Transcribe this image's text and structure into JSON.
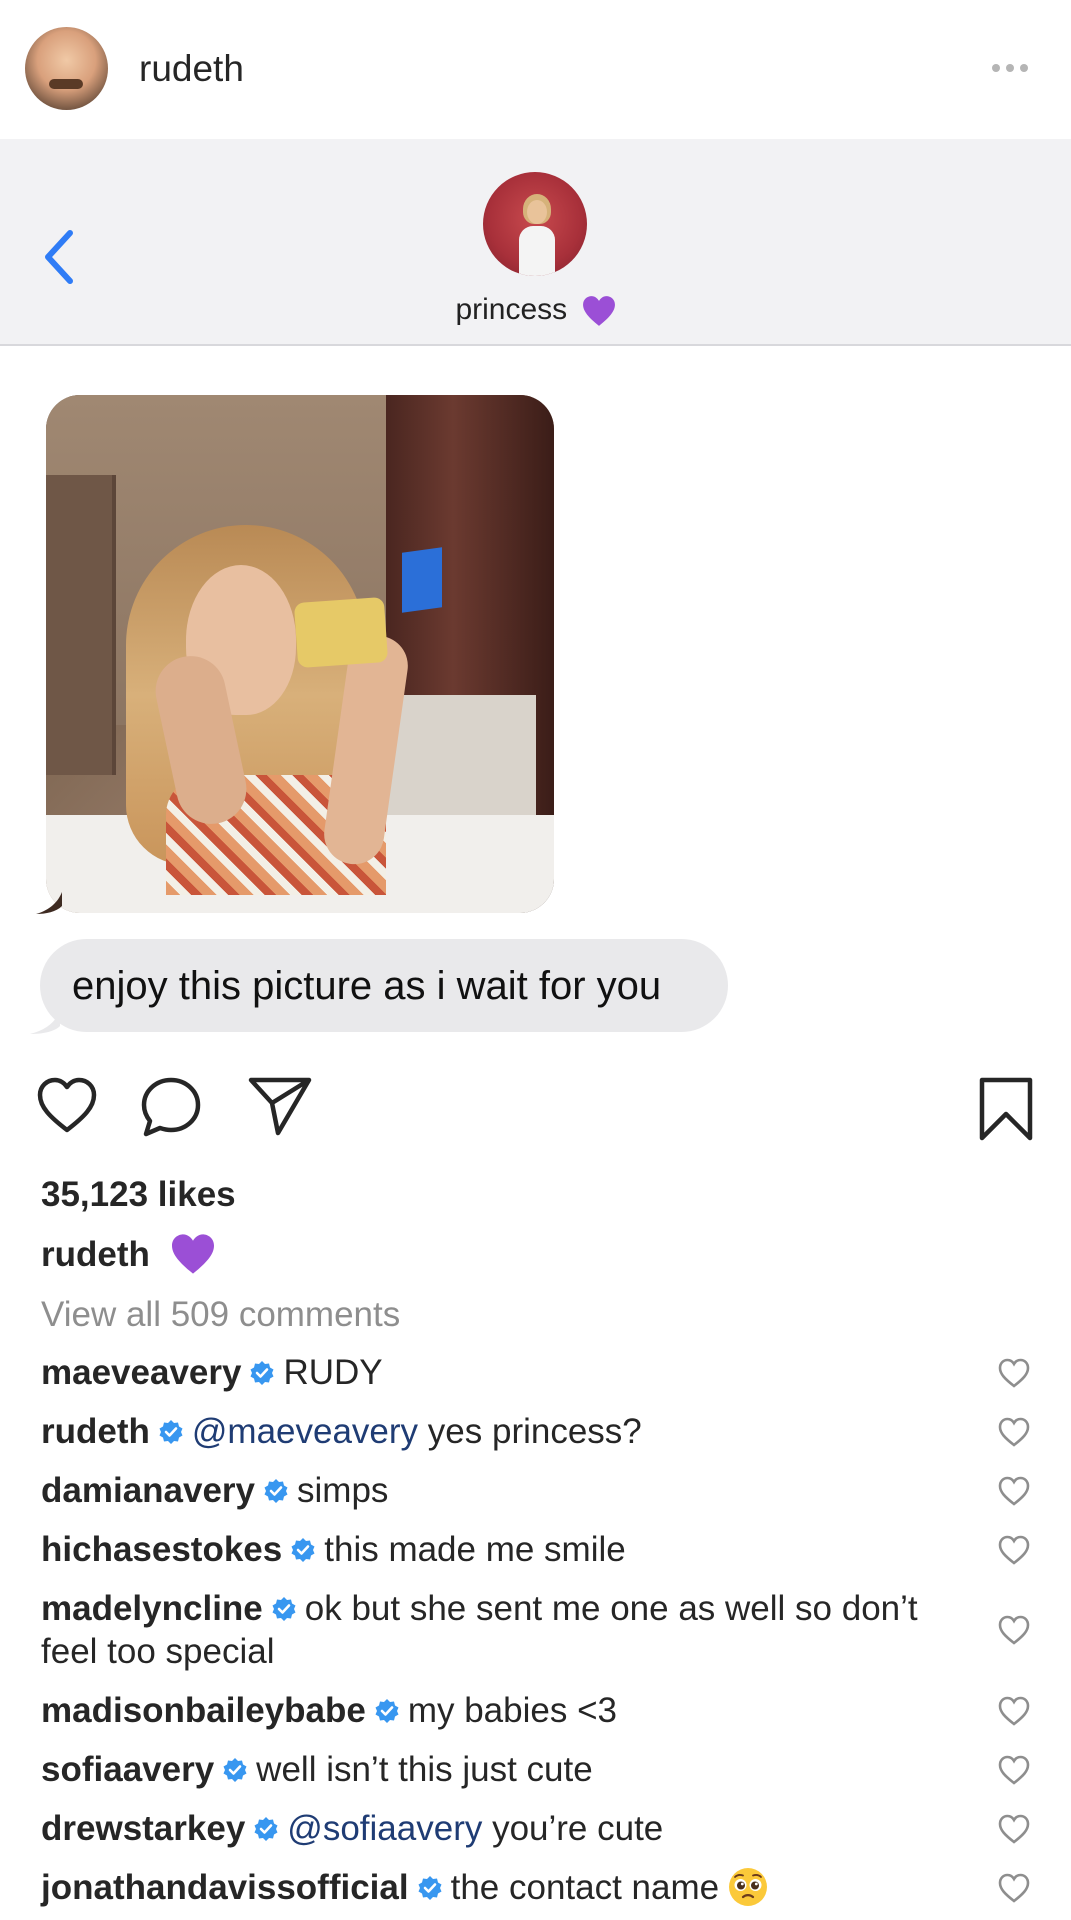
{
  "post": {
    "username": "rudeth",
    "more_icon": "more-horizontal-icon"
  },
  "chat": {
    "back_icon": "chevron-left-icon",
    "contact_name": "princess",
    "contact_emoji": "purple-heart",
    "message": "enjoy this picture as i wait for you"
  },
  "actions": {
    "like_icon": "heart-outline-icon",
    "comment_icon": "comment-bubble-icon",
    "share_icon": "paper-plane-icon",
    "save_icon": "bookmark-icon"
  },
  "meta": {
    "likes": "35,123 likes",
    "caption_user": "rudeth",
    "caption_emoji": "purple-heart",
    "view_all": "View all 509 comments"
  },
  "comments": [
    {
      "user": "maeveavery",
      "verified": true,
      "mention": "",
      "text": "RUDY"
    },
    {
      "user": "rudeth",
      "verified": true,
      "mention": "@maeveavery",
      "text": " yes princess?"
    },
    {
      "user": "damianavery",
      "verified": true,
      "mention": "",
      "text": "simps"
    },
    {
      "user": "hichasestokes",
      "verified": true,
      "mention": "",
      "text": "this made me smile"
    },
    {
      "user": "madelyncline",
      "verified": true,
      "mention": "",
      "text": "ok but she sent me one as well so don’t feel too special"
    },
    {
      "user": "madisonbaileybabe",
      "verified": true,
      "mention": "",
      "text": "my babies <3"
    },
    {
      "user": "sofiaavery",
      "verified": true,
      "mention": "",
      "text": "well isn’t this just cute"
    },
    {
      "user": "drewstarkey",
      "verified": true,
      "mention": "@sofiaavery",
      "text": " you’re cute"
    },
    {
      "user": "jonathandavissofficial",
      "verified": true,
      "mention": "",
      "text": "the contact name",
      "emoji": "pleading-face"
    }
  ],
  "colors": {
    "verified_blue": "#3897f0",
    "mention_navy": "#1f3c74",
    "ios_blue": "#2f7cf6",
    "purple_heart": "#9b4fd6"
  }
}
